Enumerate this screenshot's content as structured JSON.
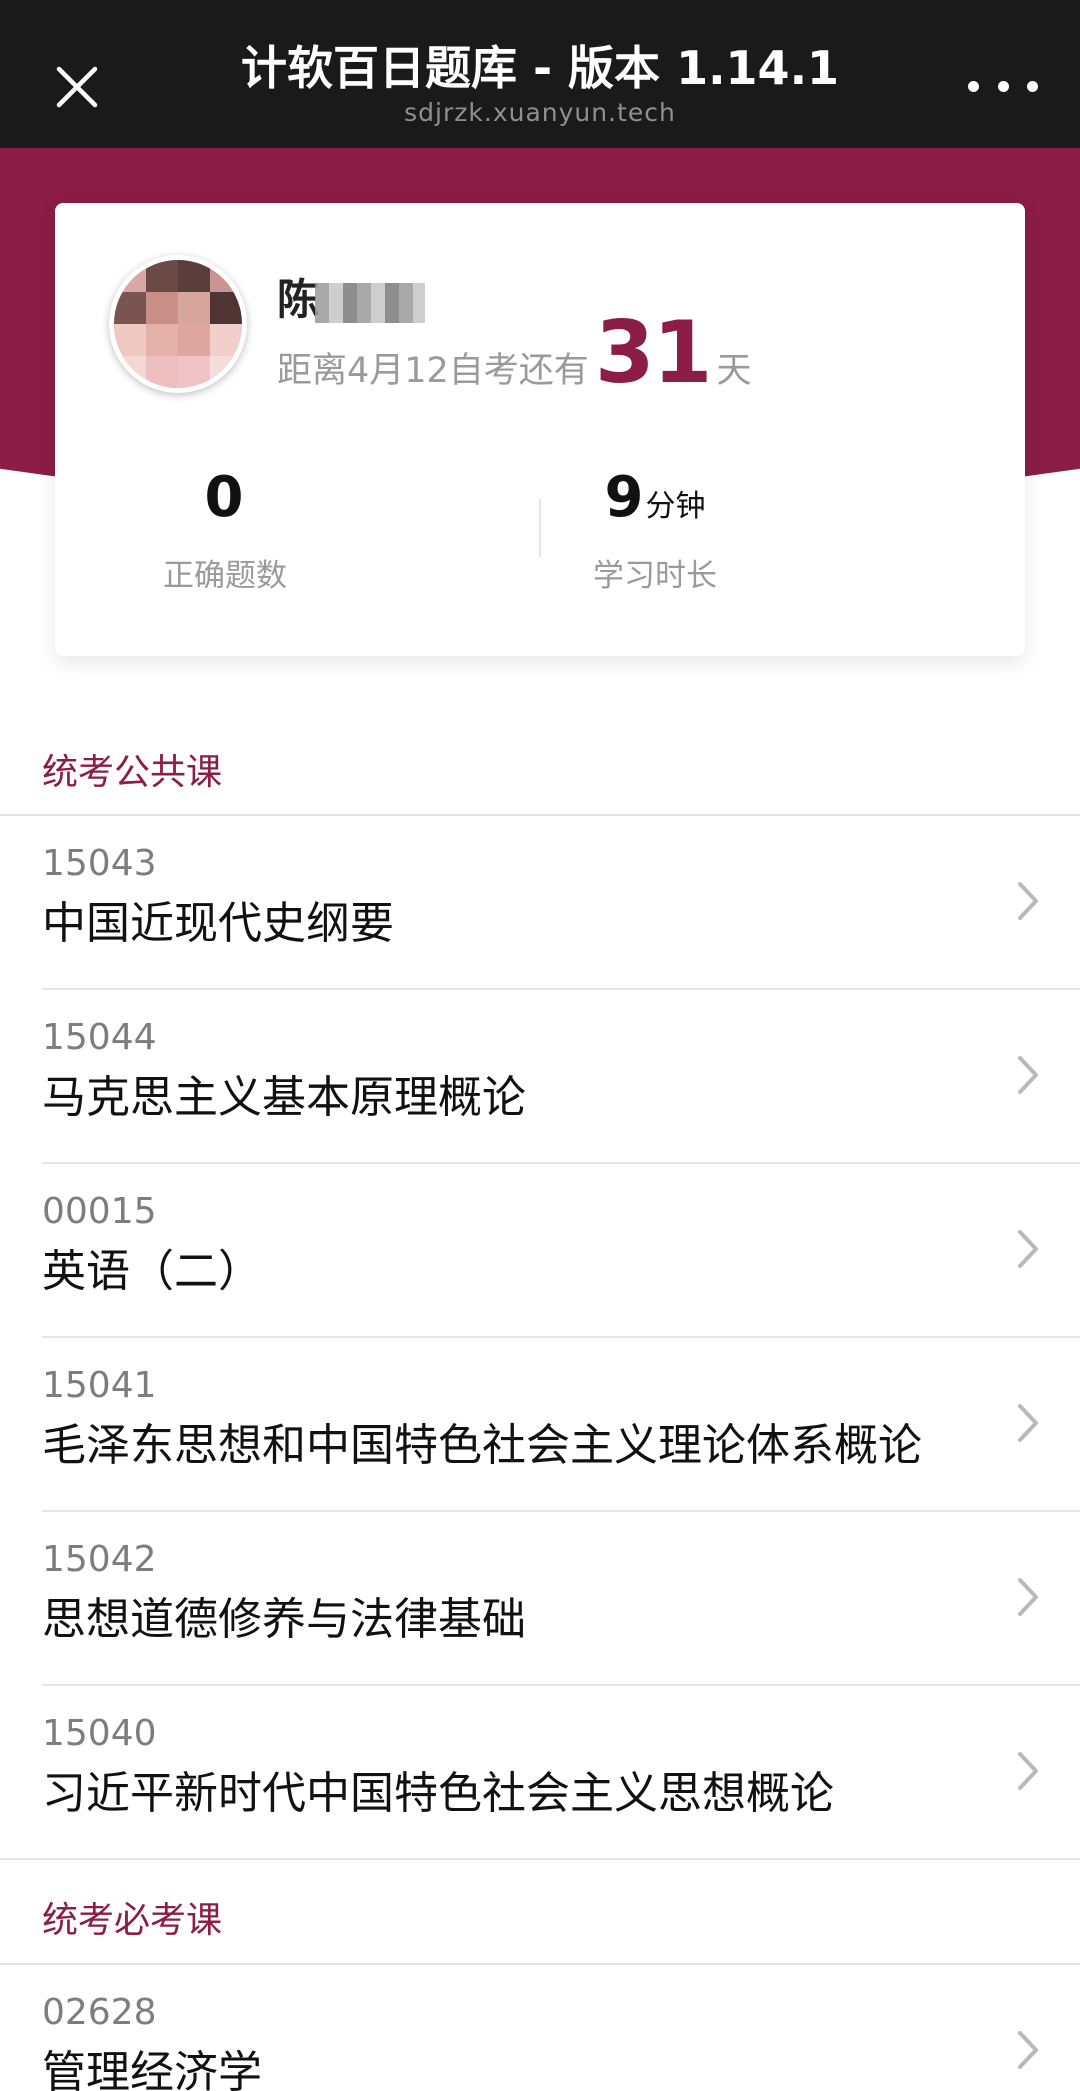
{
  "navbar": {
    "title": "计软百日题库 - 版本 1.14.1",
    "subtitle": "sdjrzk.xuanyun.tech",
    "close_icon": "close-icon",
    "more_icon": "more-icon"
  },
  "profile": {
    "name_visible": "陈",
    "countdown_prefix": "距离4月12自考还有",
    "countdown_days": "31",
    "countdown_suffix": "天",
    "stats": [
      {
        "value": "0",
        "unit": "",
        "label": "正确题数"
      },
      {
        "value": "9",
        "unit": "分钟",
        "label": "学习时长"
      }
    ]
  },
  "sections": [
    {
      "title": "统考公共课",
      "courses": [
        {
          "code": "15043",
          "name": "中国近现代史纲要"
        },
        {
          "code": "15044",
          "name": "马克思主义基本原理概论"
        },
        {
          "code": "00015",
          "name": "英语（二）"
        },
        {
          "code": "15041",
          "name": "毛泽东思想和中国特色社会主义理论体系概论"
        },
        {
          "code": "15042",
          "name": "思想道德修养与法律基础"
        },
        {
          "code": "15040",
          "name": "习近平新时代中国特色社会主义思想概论"
        }
      ]
    },
    {
      "title": "统考必考课",
      "courses": [
        {
          "code": "02628",
          "name": "管理经济学"
        }
      ]
    }
  ],
  "colors": {
    "accent": "#8b1d46",
    "navbar_bg": "#1a1a1a",
    "muted_text": "#9a9a9a"
  }
}
